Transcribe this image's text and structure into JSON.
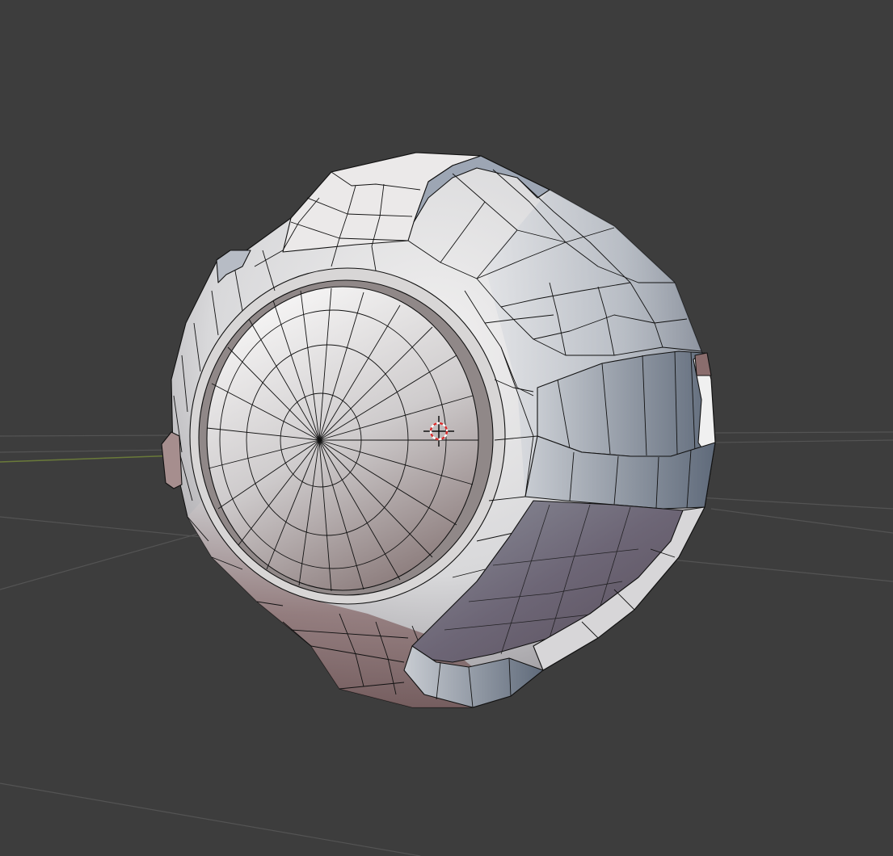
{
  "viewport": {
    "background_color": "#3d3d3d",
    "grid_color": "#545454",
    "x_axis_color": "#6a7a3a",
    "wire_color": "#111111"
  },
  "model": {
    "light_face_color": "#e8e6e6",
    "mid_face_color": "#b4b8bf",
    "shadow_face_color": "#7f6868",
    "cool_shadow_color": "#6d7785"
  },
  "cursor": {
    "icon": "3d-cursor-icon",
    "ring_color_a": "#d92b2b",
    "ring_color_b": "#ffffff"
  }
}
